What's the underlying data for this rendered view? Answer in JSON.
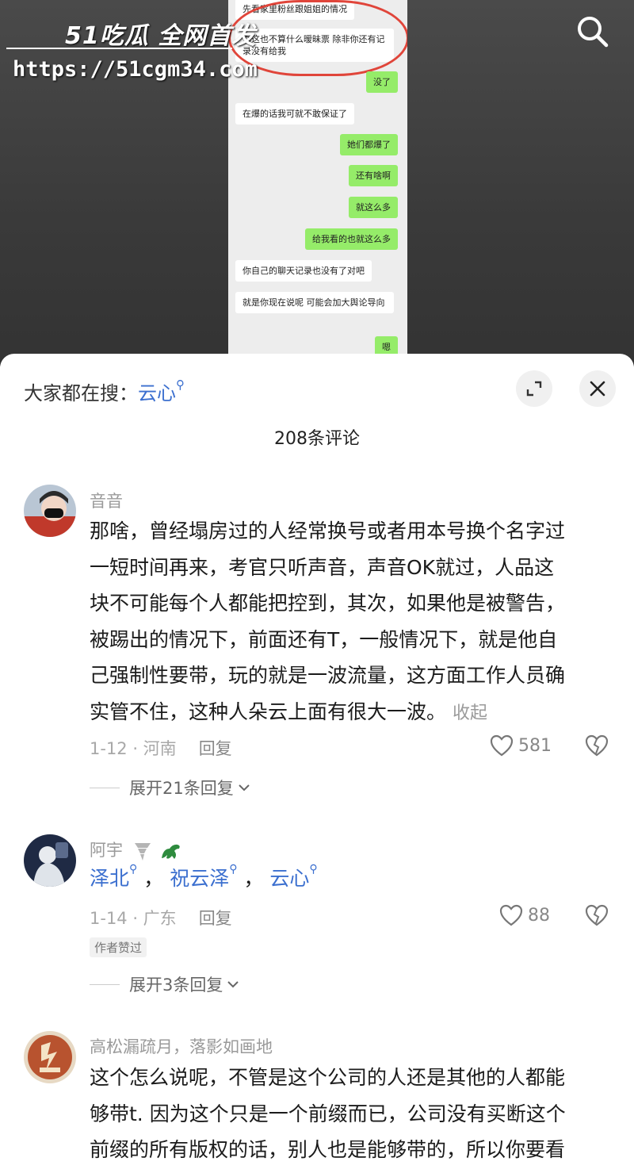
{
  "watermark": {
    "logo": "51吃瓜 全网首发",
    "url": "https://51cgm34.com"
  },
  "chat": {
    "messages": [
      {
        "side": "left",
        "text": "先看家里粉丝跟姐姐的情况"
      },
      {
        "side": "left",
        "text": "你这也不算什么暧昧票 除非你还有记录没有给我"
      },
      {
        "side": "right",
        "text": "没了"
      },
      {
        "side": "left",
        "text": "在爆的话我可就不敢保证了"
      },
      {
        "side": "right",
        "text": "她们都爆了"
      },
      {
        "side": "right",
        "text": "还有啥啊"
      },
      {
        "side": "right",
        "text": "就这么多"
      },
      {
        "side": "right",
        "text": "给我看的也就这么多"
      },
      {
        "side": "left",
        "text": "你自己的聊天记录也没有了对吧"
      },
      {
        "side": "left",
        "text": "就是你现在说呢 可能会加大舆论导向"
      },
      {
        "side": "right",
        "text": "嗯"
      }
    ]
  },
  "panel": {
    "hot_search_prefix": "大家都在搜：",
    "hot_search_keyword": "云心",
    "comment_count": "208条评论"
  },
  "comments": [
    {
      "user": "音音",
      "lines": [
        "那啥，曾经塌房过的人经常换号或者用本号换个名字过",
        "一短时间再来，考官只听声音，声音OK就过，人品这",
        "块不可能每个人都能把控到，其次，如果他是被警告，",
        "被踢出的情况下，前面还有T，一般情况下，就是他自",
        "己强制性要带，玩的就是一波流量，这方面工作人员确",
        "实管不住，这种人朵云上面有很大一波。"
      ],
      "fold": "收起",
      "date_loc": "1-12 · 河南",
      "reply": "回复",
      "likes": "581",
      "more": "展开21条回复"
    },
    {
      "user": "阿宇",
      "mentions": [
        "泽北",
        "祝云泽",
        "云心"
      ],
      "date_loc": "1-14 · 广东",
      "reply": "回复",
      "likes": "88",
      "badge": "作者赞过",
      "more": "展开3条回复"
    },
    {
      "user": "高松漏疏月，落影如画地",
      "lines": [
        "这个怎么说呢，不管是这个公司的人还是其他的人都能",
        "够带t. 因为这个只是一个前缀而已，公司没有买断这个",
        "前缀的所有版权的话，别人也是能够带的，所以你要看"
      ]
    }
  ],
  "colors": {
    "link": "#3b6fcf",
    "wechat_green": "#95ec69",
    "mark_red": "#e0453a"
  }
}
